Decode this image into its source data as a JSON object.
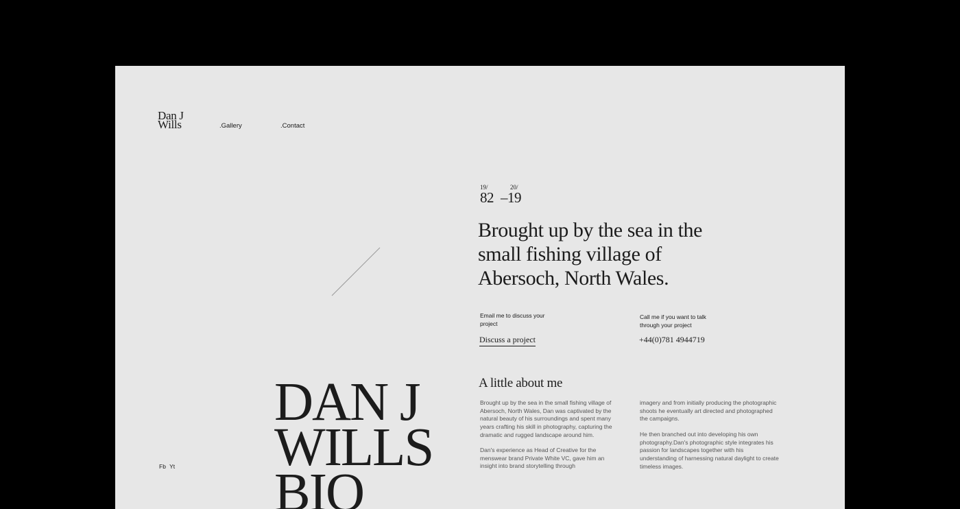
{
  "header": {
    "logo_line1": "Dan J",
    "logo_line2": "Wills",
    "nav": {
      "gallery": ".Gallery",
      "contact": ".Contact"
    }
  },
  "years": {
    "start_prefix": "19/",
    "start_suffix": "82",
    "end_prefix": "20/",
    "end_suffix": "–19"
  },
  "hero": {
    "headline": "Brought up by the sea in the small fishing village of Abersoch, North Wales."
  },
  "contact": {
    "email_caption": "Email me to discuss your project",
    "email_cta": "Discuss a project",
    "call_caption": "Call me if you want to talk through your project",
    "phone": "+44(0)781 4944719"
  },
  "about": {
    "title": "A little about me",
    "col1_p1": "Brought up by the sea in the small fishing village of Abersoch, North Wales, Dan was captivated by the natural beauty of his surroundings and spent many years crafting his skill in photography, capturing the dramatic and rugged landscape around him.",
    "col1_p2": "Dan's experience as Head of Creative for the menswear brand Private White VC, gave him an insight into brand storytelling through",
    "col2_p1": "imagery and from initially producing the photographic shoots he eventually art directed and photographed the campaigns.",
    "col2_p2": "He then branched out into developing his own photography.Dan's photographic style integrates his passion for landscapes together with his understanding of harnessing natural daylight to create timeless images."
  },
  "big_title": {
    "line1": "DAN J",
    "line2": "WILLS",
    "line3": "BIO"
  },
  "social": {
    "fb": "Fb",
    "yt": "Yt"
  }
}
